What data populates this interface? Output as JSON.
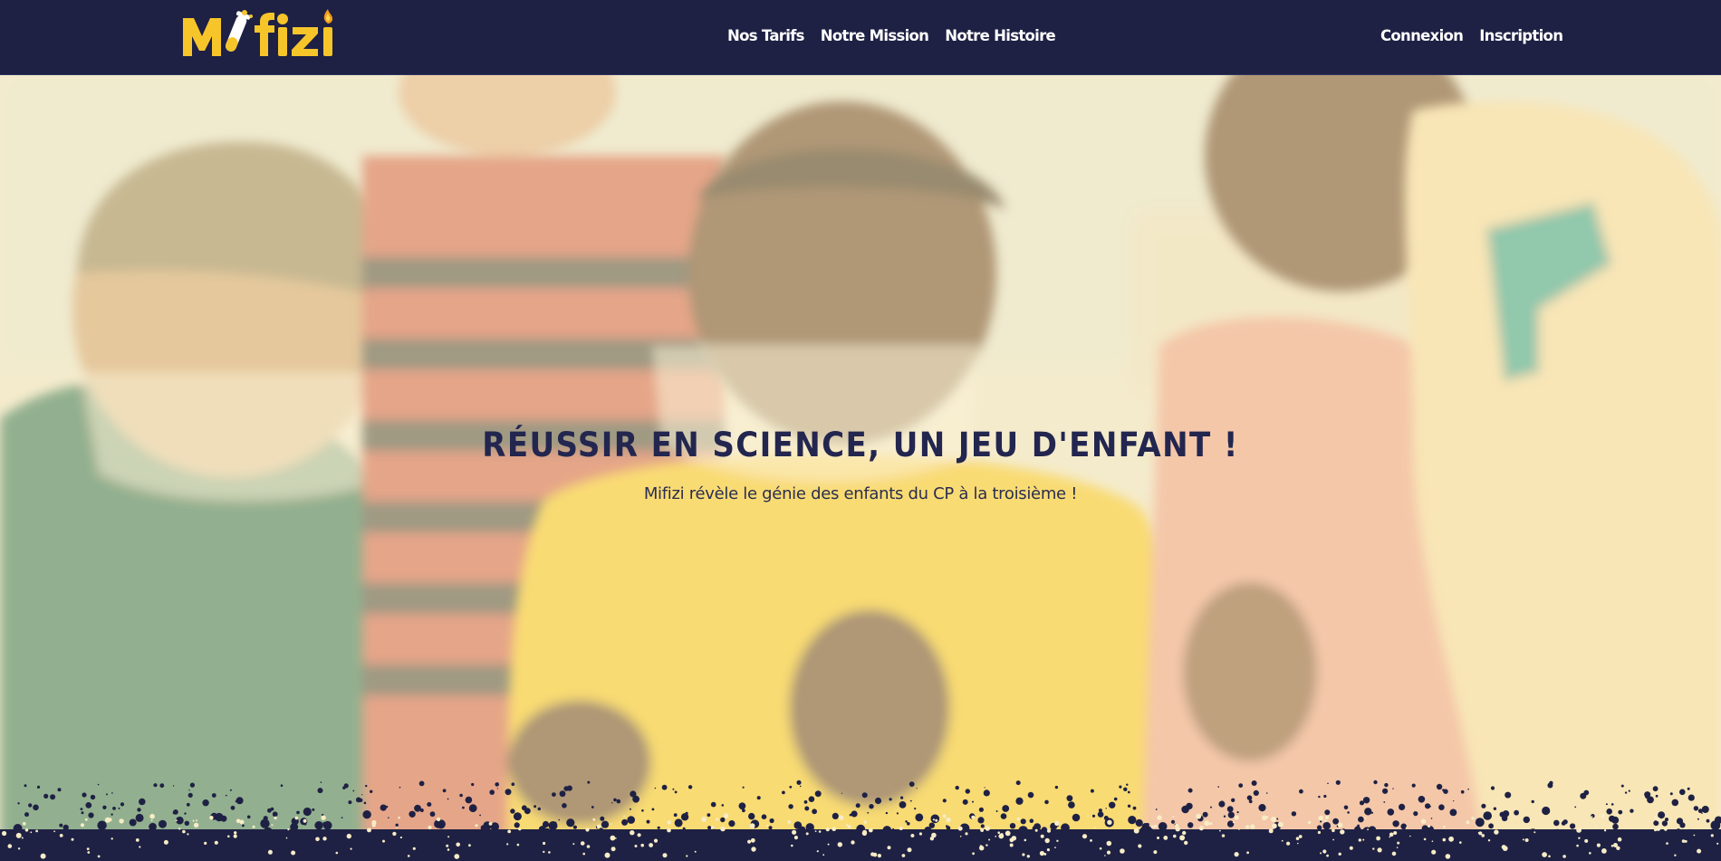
{
  "header": {
    "logo_text": "Mifizi",
    "nav_main": [
      {
        "label": "Nos Tarifs"
      },
      {
        "label": "Notre Mission"
      },
      {
        "label": "Notre Histoire"
      }
    ],
    "nav_account": [
      {
        "label": "Connexion"
      },
      {
        "label": "Inscription"
      }
    ]
  },
  "hero": {
    "title": "RÉUSSIR EN SCIENCE, UN JEU D'ENFANT !",
    "subtitle": "Mifizi révèle le génie des enfants du CP à la troisième !"
  },
  "colors": {
    "navy": "#1e2144",
    "brand_yellow": "#f6c52a",
    "overlay_cream": "#fff1c4",
    "title_text": "#23264f"
  }
}
